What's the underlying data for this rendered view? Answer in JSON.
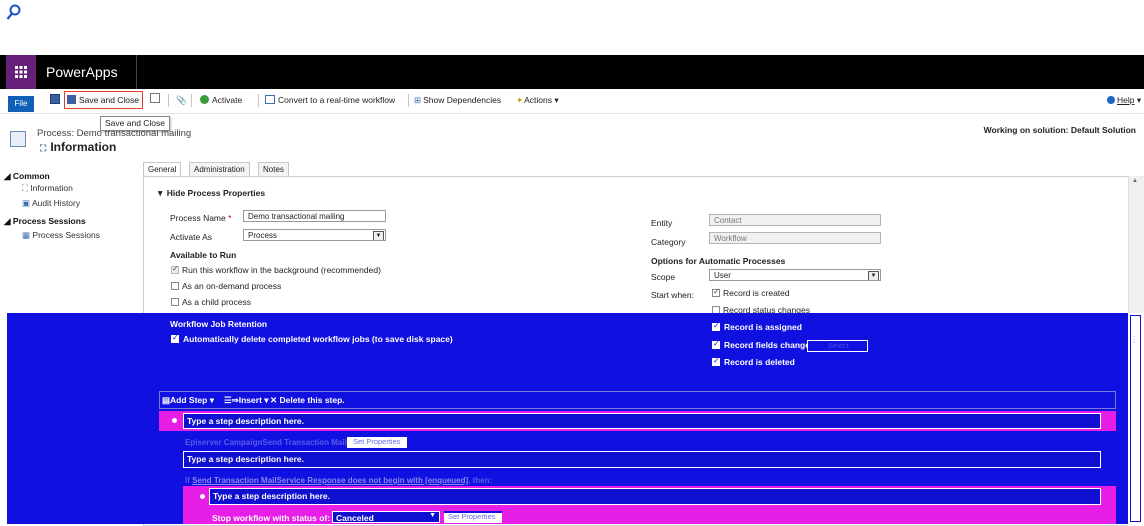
{
  "search": {
    "icon": "search-icon"
  },
  "nav": {
    "brand": "PowerApps",
    "waffle_icon": "waffle-icon",
    "waffle_color": "#68217a"
  },
  "ribbon": {
    "file": "File",
    "save_close": "Save and Close",
    "activate": "Activate",
    "convert": "Convert to a real-time workflow",
    "show_dependencies": "Show Dependencies",
    "actions": "Actions",
    "help": "Help",
    "tooltip": "Save and Close"
  },
  "header": {
    "process_title": "Process: Demo transactional mailing",
    "form_title": "Information",
    "solution": "Working on solution: Default Solution"
  },
  "leftnav": {
    "common": "Common",
    "information": "Information",
    "audit_history": "Audit History",
    "process_sessions_header": "Process Sessions",
    "process_sessions": "Process Sessions"
  },
  "tabs": [
    "General",
    "Administration",
    "Notes"
  ],
  "form": {
    "section": "Hide Process Properties",
    "process_name_label": "Process Name",
    "process_name_value": "Demo transactional mailing",
    "activate_as_label": "Activate As",
    "activate_as_value": "Process",
    "available_label": "Available to Run",
    "run_bg": "Run this workflow in the background (recommended)",
    "on_demand": "As an on-demand process",
    "child": "As a child process",
    "entity_label": "Entity",
    "entity_value": "Contact",
    "category_label": "Category",
    "category_value": "Workflow",
    "options_label": "Options for Automatic Processes",
    "scope_label": "Scope",
    "scope_value": "User",
    "start_when_label": "Start when:",
    "record_created": "Record is created",
    "record_status": "Record status changes",
    "record_assigned": "Record is assigned",
    "record_fields": "Record fields change",
    "record_fields_btn": "Select",
    "record_deleted": "Record is deleted",
    "retention_label": "Workflow Job Retention",
    "retention_auto": "Automatically delete completed workflow jobs (to save disk space)"
  },
  "steps": {
    "add_step": "Add Step",
    "insert": "Insert",
    "delete": "Delete this step.",
    "placeholder1": "Type a step description here.",
    "step_name": "Episerver CampaignSend Transaction Mail",
    "set_properties": "Set Properties",
    "placeholder2": "Type a step description here.",
    "condition_if": "If",
    "condition_text": "Send Transaction MailService Response does not begin with [enqueued]",
    "condition_then": ", then:",
    "placeholder3": "Type a step description here.",
    "stop_label": "Stop workflow with status of:",
    "stop_value": "Canceled",
    "set_properties2": "Set Properties"
  },
  "colors": {
    "overlay_blue": "#1010e0",
    "magenta": "#e61ee6",
    "file_blue": "#1160b7",
    "highlight_red": "#e0402a"
  }
}
